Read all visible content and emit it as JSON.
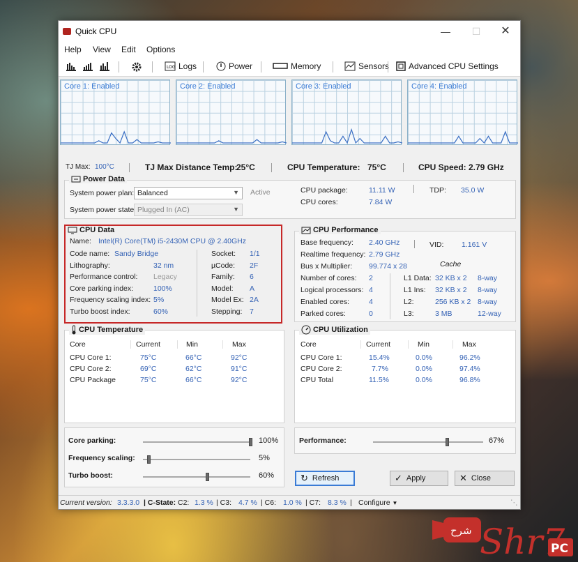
{
  "window": {
    "title": "Quick CPU",
    "minimize_icon": "minimize-icon",
    "maximize_icon": "maximize-icon",
    "close_icon": "close-icon"
  },
  "menu": [
    "Help",
    "View",
    "Edit",
    "Options"
  ],
  "toolbar": {
    "logs": "Logs",
    "power": "Power",
    "memory": "Memory",
    "sensors": "Sensors",
    "advanced": "Advanced CPU Settings"
  },
  "cores": [
    {
      "label": "Core 1: Enabled",
      "load": [
        0,
        0,
        0,
        0,
        0,
        0,
        0,
        0,
        0,
        2,
        0,
        0,
        9,
        4,
        0,
        10,
        0,
        0,
        3,
        0,
        0,
        0,
        0,
        1,
        0,
        0,
        0
      ]
    },
    {
      "label": "Core 2: Enabled",
      "load": [
        0,
        0,
        0,
        0,
        0,
        0,
        0,
        0,
        0,
        0,
        2,
        0,
        0,
        0,
        0,
        0,
        0,
        0,
        0,
        3,
        0,
        0,
        0,
        0,
        0,
        1,
        0
      ]
    },
    {
      "label": "Core 3: Enabled",
      "load": [
        0,
        0,
        0,
        0,
        0,
        0,
        0,
        0,
        10,
        2,
        0,
        0,
        6,
        0,
        12,
        0,
        4,
        0,
        0,
        0,
        0,
        0,
        6,
        0,
        0,
        1,
        0
      ]
    },
    {
      "label": "Core 4: Enabled",
      "load": [
        0,
        0,
        0,
        0,
        0,
        0,
        0,
        0,
        0,
        0,
        0,
        0,
        6,
        0,
        0,
        0,
        0,
        4,
        0,
        6,
        0,
        0,
        0,
        10,
        0,
        0,
        0
      ]
    }
  ],
  "stats": {
    "tj_max_label": "TJ Max:",
    "tj_max": "100°C",
    "tj_dist_label": "TJ Max Distance Temp:",
    "tj_dist": "25°C",
    "cpu_temp_label": "CPU Temperature:",
    "cpu_temp": "75°C",
    "cpu_speed_label": "CPU Speed:",
    "cpu_speed": "2.79 GHz"
  },
  "power": {
    "title": "Power Data",
    "plan_label": "System power plan:",
    "plan_value": "Balanced",
    "plan_status": "Active",
    "state_label": "System power state:",
    "state_value": "Plugged In (AC)",
    "pkg_label": "CPU package:",
    "pkg_value": "11.11 W",
    "cores_label": "CPU cores:",
    "cores_value": "7.84 W",
    "tdp_label": "TDP:",
    "tdp_value": "35.0 W"
  },
  "cpu_data": {
    "title": "CPU Data",
    "name_label": "Name:",
    "name_value": "Intel(R) Core(TM) i5-2430M CPU @ 2.40GHz",
    "left": [
      {
        "label": "Code name:",
        "value": "Sandy Bridge"
      },
      {
        "label": "Lithography:",
        "value": "32 nm"
      },
      {
        "label": "Performance control:",
        "value": "Legacy"
      },
      {
        "label": "Core parking index:",
        "value": "100%"
      },
      {
        "label": "Frequency scaling index:",
        "value": "5%"
      },
      {
        "label": "Turbo boost index:",
        "value": "60%"
      }
    ],
    "right": [
      {
        "label": "Socket:",
        "value": "1/1"
      },
      {
        "label": "µCode:",
        "value": "2F"
      },
      {
        "label": "Family:",
        "value": "6"
      },
      {
        "label": "Model:",
        "value": "A"
      },
      {
        "label": "Model Ex:",
        "value": "2A"
      },
      {
        "label": "Stepping:",
        "value": "7"
      }
    ]
  },
  "cpu_perf": {
    "title": "CPU Performance",
    "base_label": "Base frequency:",
    "base_value": "2.40 GHz",
    "vid_label": "VID:",
    "vid_value": "1.161 V",
    "rt_label": "Realtime frequency:",
    "rt_value": "2.79 GHz",
    "mult_label": "Bus x Multiplier:",
    "mult_value": "99.774 x 28",
    "cache_label": "Cache",
    "rows": [
      {
        "label": "Number of cores:",
        "value": "2",
        "clabel": "L1 Data:",
        "cvalue": "32 KB x 2",
        "way": "8-way"
      },
      {
        "label": "Logical processors:",
        "value": "4",
        "clabel": "L1 Ins:",
        "cvalue": "32 KB x 2",
        "way": "8-way"
      },
      {
        "label": "Enabled cores:",
        "value": "4",
        "clabel": "L2:",
        "cvalue": "256 KB x 2",
        "way": "8-way"
      },
      {
        "label": "Parked cores:",
        "value": "0",
        "clabel": "L3:",
        "cvalue": "3 MB",
        "way": "12-way"
      }
    ]
  },
  "cpu_temp": {
    "title": "CPU Temperature",
    "headers": [
      "Core",
      "Current",
      "Min",
      "Max"
    ],
    "rows": [
      [
        "CPU Core 1:",
        "75°C",
        "66°C",
        "92°C"
      ],
      [
        "CPU Core 2:",
        "69°C",
        "62°C",
        "91°C"
      ],
      [
        "CPU Package",
        "75°C",
        "66°C",
        "92°C"
      ]
    ]
  },
  "cpu_util": {
    "title": "CPU Utilization",
    "headers": [
      "Core",
      "Current",
      "Min",
      "Max"
    ],
    "rows": [
      [
        "CPU Core 1:",
        "15.4%",
        "0.0%",
        "96.2%"
      ],
      [
        "CPU Core 2:",
        "7.7%",
        "0.0%",
        "97.4%"
      ],
      [
        "CPU Total",
        "11.5%",
        "0.0%",
        "96.8%"
      ]
    ]
  },
  "sliders": {
    "core_parking": {
      "label": "Core parking:",
      "value": "100%",
      "level": 1.0
    },
    "freq_scaling": {
      "label": "Frequency scaling:",
      "value": "5%",
      "level": 0.05
    },
    "turbo_boost": {
      "label": "Turbo boost:",
      "value": "60%",
      "level": 0.6
    },
    "performance": {
      "label": "Performance:",
      "value": "67%",
      "level": 0.67
    }
  },
  "buttons": {
    "refresh": "Refresh",
    "apply": "Apply",
    "close": "Close"
  },
  "status": {
    "version_label": "Current version:",
    "version": "3.3.3.0",
    "cstate_label": "C-State:",
    "c2": "C2:",
    "c2_val": "1.3 %",
    "c3": "C3:",
    "c3_val": "4.7 %",
    "c6": "C6:",
    "c6_val": "1.0 %",
    "c7": "C7:",
    "c7_val": "8.3 %",
    "configure": "Configure"
  },
  "watermark": {
    "arabic": "شرح",
    "brand": "Shr7",
    "pc": "PC"
  },
  "colors": {
    "accent": "#3a7bd5",
    "value_blue": "#3462b5",
    "highlight_red": "#c62828",
    "graph_line": "#3a6fc4"
  }
}
